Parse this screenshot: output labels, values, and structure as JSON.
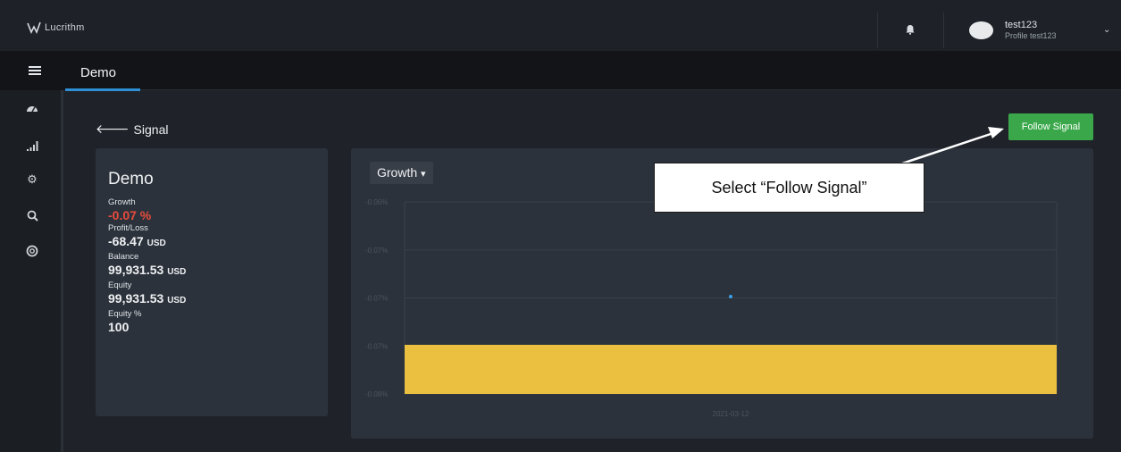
{
  "app": {
    "logo_text": "Lucrithm"
  },
  "user": {
    "name": "test123",
    "profile": "Profile test123"
  },
  "header": {
    "tab": "Demo"
  },
  "nav": {
    "back_label": "Signal"
  },
  "actions": {
    "follow_label": "Follow Signal"
  },
  "stats": {
    "title": "Demo",
    "growth_label": "Growth",
    "growth_value": "-0.07 %",
    "pl_label": "Profit/Loss",
    "pl_value": "-68.47",
    "pl_unit": "USD",
    "balance_label": "Balance",
    "balance_value": "99,931.53",
    "balance_unit": "USD",
    "equity_label": "Equity",
    "equity_value": "99,931.53",
    "equity_unit": "USD",
    "equitypct_label": "Equity %",
    "equitypct_value": "100"
  },
  "chart": {
    "dropdown_label": "Growth"
  },
  "annotation": {
    "text": "Select “Follow Signal”"
  },
  "colors": {
    "accent": "#2f8fd4",
    "button": "#3aa84a",
    "negative": "#e74c3c",
    "bar": "#ebc040"
  },
  "chart_data": {
    "type": "bar",
    "categories": [
      "2021-03-12"
    ],
    "values": [
      -0.07
    ],
    "y_ticks": [
      "-0.06%",
      "-0.07%",
      "-0.07%",
      "-0.07%",
      "-0.08%"
    ],
    "grid": true
  }
}
